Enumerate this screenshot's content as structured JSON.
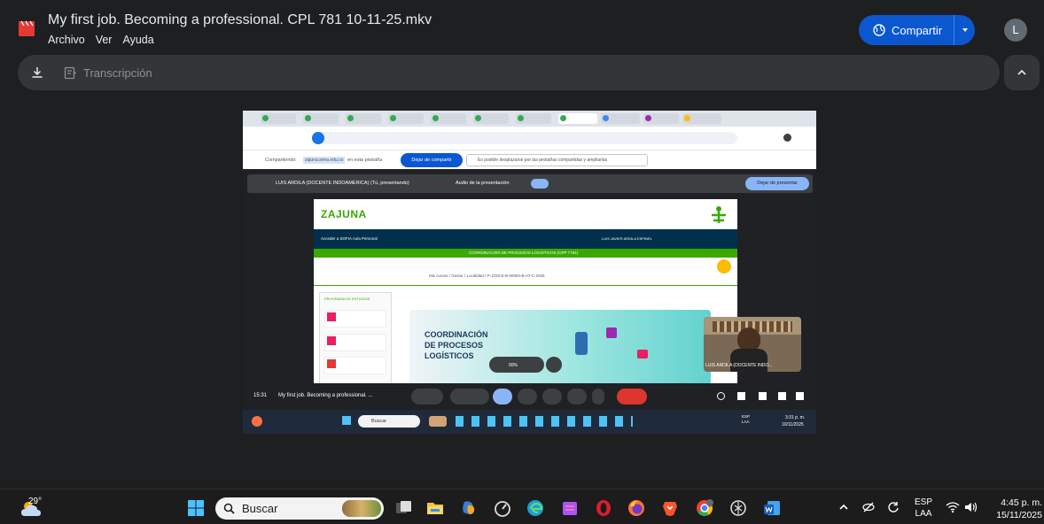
{
  "window": {
    "title": "My first job. Becoming a professional. CPL 781 10-11-25.mkv",
    "menu": [
      "Archivo",
      "Ver",
      "Ayuda"
    ],
    "share_label": "Compartir",
    "avatar_letter": "L"
  },
  "toolbar": {
    "transcription_label": "Transcripción"
  },
  "video": {
    "sharing_text": "Compartiendo",
    "sharing_site": "zajuna.sena.edu.co",
    "sharing_suffix": "en esta pestaña",
    "stop_share_label": "Dejar de compartir",
    "scroll_tip": "Es posible desplazarse por las pestañas compartidas y ampliarlas",
    "presenter_label": "LUIS ARDILA (DOCENTE INDOAMERICA) (Tú, presentando)",
    "audio_label": "Audio de la presentación",
    "stop_presenting_label": "Dejar de presentar",
    "logo_text": "ZAJUNA",
    "nav_left": "Acceder a SOFIA   Aula Personal",
    "user_name": "LUIS JAVIER ARDILA ESPINEL",
    "banner_text": "COORDINACION DE PROCESOS LOGISTICOS (CPP 7781)",
    "breadcrumb": "Mis cursos / Gestor / Localidad / P-1010-E-B-00094-B-AT-C-2025",
    "sidebar_title": "PROGRAMA DE ESTUDIOS",
    "hero_text_1": "COORDINACIÓN",
    "hero_text_2": "DE PROCESOS",
    "hero_text_3": "LOGÍSTICOS",
    "zoom_label": "90%",
    "cam_label": "LUIS ARDILA (DOCENTE INDO...",
    "meet_time": "15:31",
    "meet_title": "My first job. Becoming a professional. ...",
    "inner_search": "Buscar",
    "inner_clock_time": "3:31 p. m.",
    "inner_clock_date": "10/11/2025",
    "inner_lang": "ESP LAA"
  },
  "taskbar": {
    "temperature": "29°",
    "search_placeholder": "Buscar",
    "lang_1": "ESP",
    "lang_2": "LAA",
    "time": "4:45 p. m.",
    "date": "15/11/2025"
  }
}
